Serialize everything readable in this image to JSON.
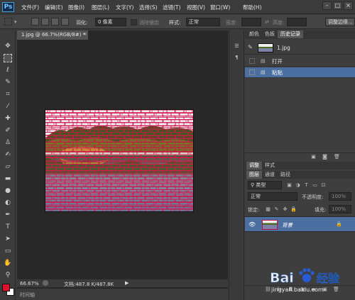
{
  "app": {
    "logo": "Ps",
    "brand_color": "#0f2d4e"
  },
  "menu": [
    "文件(F)",
    "编辑(E)",
    "图像(I)",
    "图层(L)",
    "文字(Y)",
    "选择(S)",
    "滤镜(T)",
    "视图(V)",
    "窗口(W)",
    "帮助(H)"
  ],
  "options": {
    "feather_label": "羽化:",
    "feather_value": "0 像素",
    "antialias_label": "消除锯齿",
    "style_label": "样式:",
    "style_value": "正常",
    "width_label": "宽度:",
    "height_label": "高度:",
    "refine_button": "调整边缘..."
  },
  "document": {
    "tab_title": "1.jpg @ 66.7%(RGB/8#) *",
    "zoom": "66.67%",
    "doc_size": "文档:487.8 K/487.8K",
    "timeline_label": "时间轴"
  },
  "history_panel": {
    "tabs": [
      "颜色",
      "色板",
      "历史记录"
    ],
    "snapshot_name": "1.jpg",
    "items": [
      "打开",
      "粘贴"
    ],
    "active_index": 1
  },
  "layers_panel": {
    "top_tabs": [
      "调整",
      "样式"
    ],
    "tabs": [
      "图层",
      "通道",
      "路径"
    ],
    "filter_label": "类型",
    "blend_mode": "正常",
    "opacity_label": "不透明度:",
    "opacity_value": "100%",
    "lock_label": "锁定:",
    "fill_label": "填充:",
    "fill_value": "100%",
    "layers": [
      {
        "name": "背景",
        "locked": true
      }
    ]
  },
  "watermark": {
    "text": "Bai du 经验",
    "url": "jingyan.baidu.com"
  },
  "colors": {
    "foreground": "#e0102a",
    "background": "#ffffff",
    "selection_accent": "#4a6fa0"
  }
}
